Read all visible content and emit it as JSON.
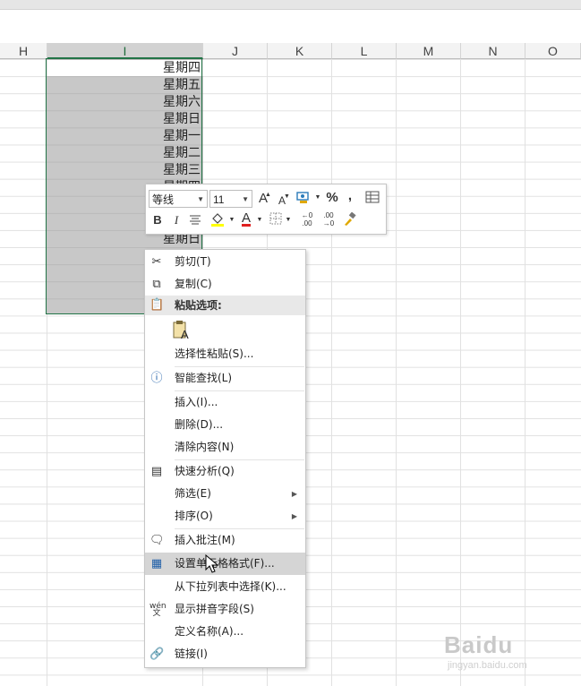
{
  "columns": [
    "H",
    "I",
    "J",
    "K",
    "L",
    "M",
    "N",
    "O"
  ],
  "cells": [
    "星期四",
    "星期五",
    "星期六",
    "星期日",
    "星期一",
    "星期二",
    "星期三",
    "星期四",
    "",
    "",
    "星期日"
  ],
  "mini_toolbar": {
    "font": "等线",
    "size": "11",
    "grow_font": "A",
    "shrink_font": "A",
    "percent": "%",
    "comma": ",",
    "bold": "B",
    "italic": "I",
    "font_color": "A",
    "inc_decimal": ".00",
    "dec_decimal": ".00"
  },
  "menu": {
    "cut": "剪切(T)",
    "copy": "复制(C)",
    "paste_options": "粘贴选项:",
    "paste_special": "选择性粘贴(S)...",
    "smart_lookup": "智能查找(L)",
    "insert": "插入(I)...",
    "delete": "删除(D)...",
    "clear": "清除内容(N)",
    "quick_analysis": "快速分析(Q)",
    "filter": "筛选(E)",
    "sort": "排序(O)",
    "insert_comment": "插入批注(M)",
    "format_cells": "设置单元格格式(F)...",
    "pick_list": "从下拉列表中选择(K)...",
    "phonetic": "显示拼音字段(S)",
    "define_name": "定义名称(A)...",
    "link": "链接(I)"
  },
  "watermark": {
    "brand": "Baidu",
    "sub": "jingyan.baidu.com"
  }
}
